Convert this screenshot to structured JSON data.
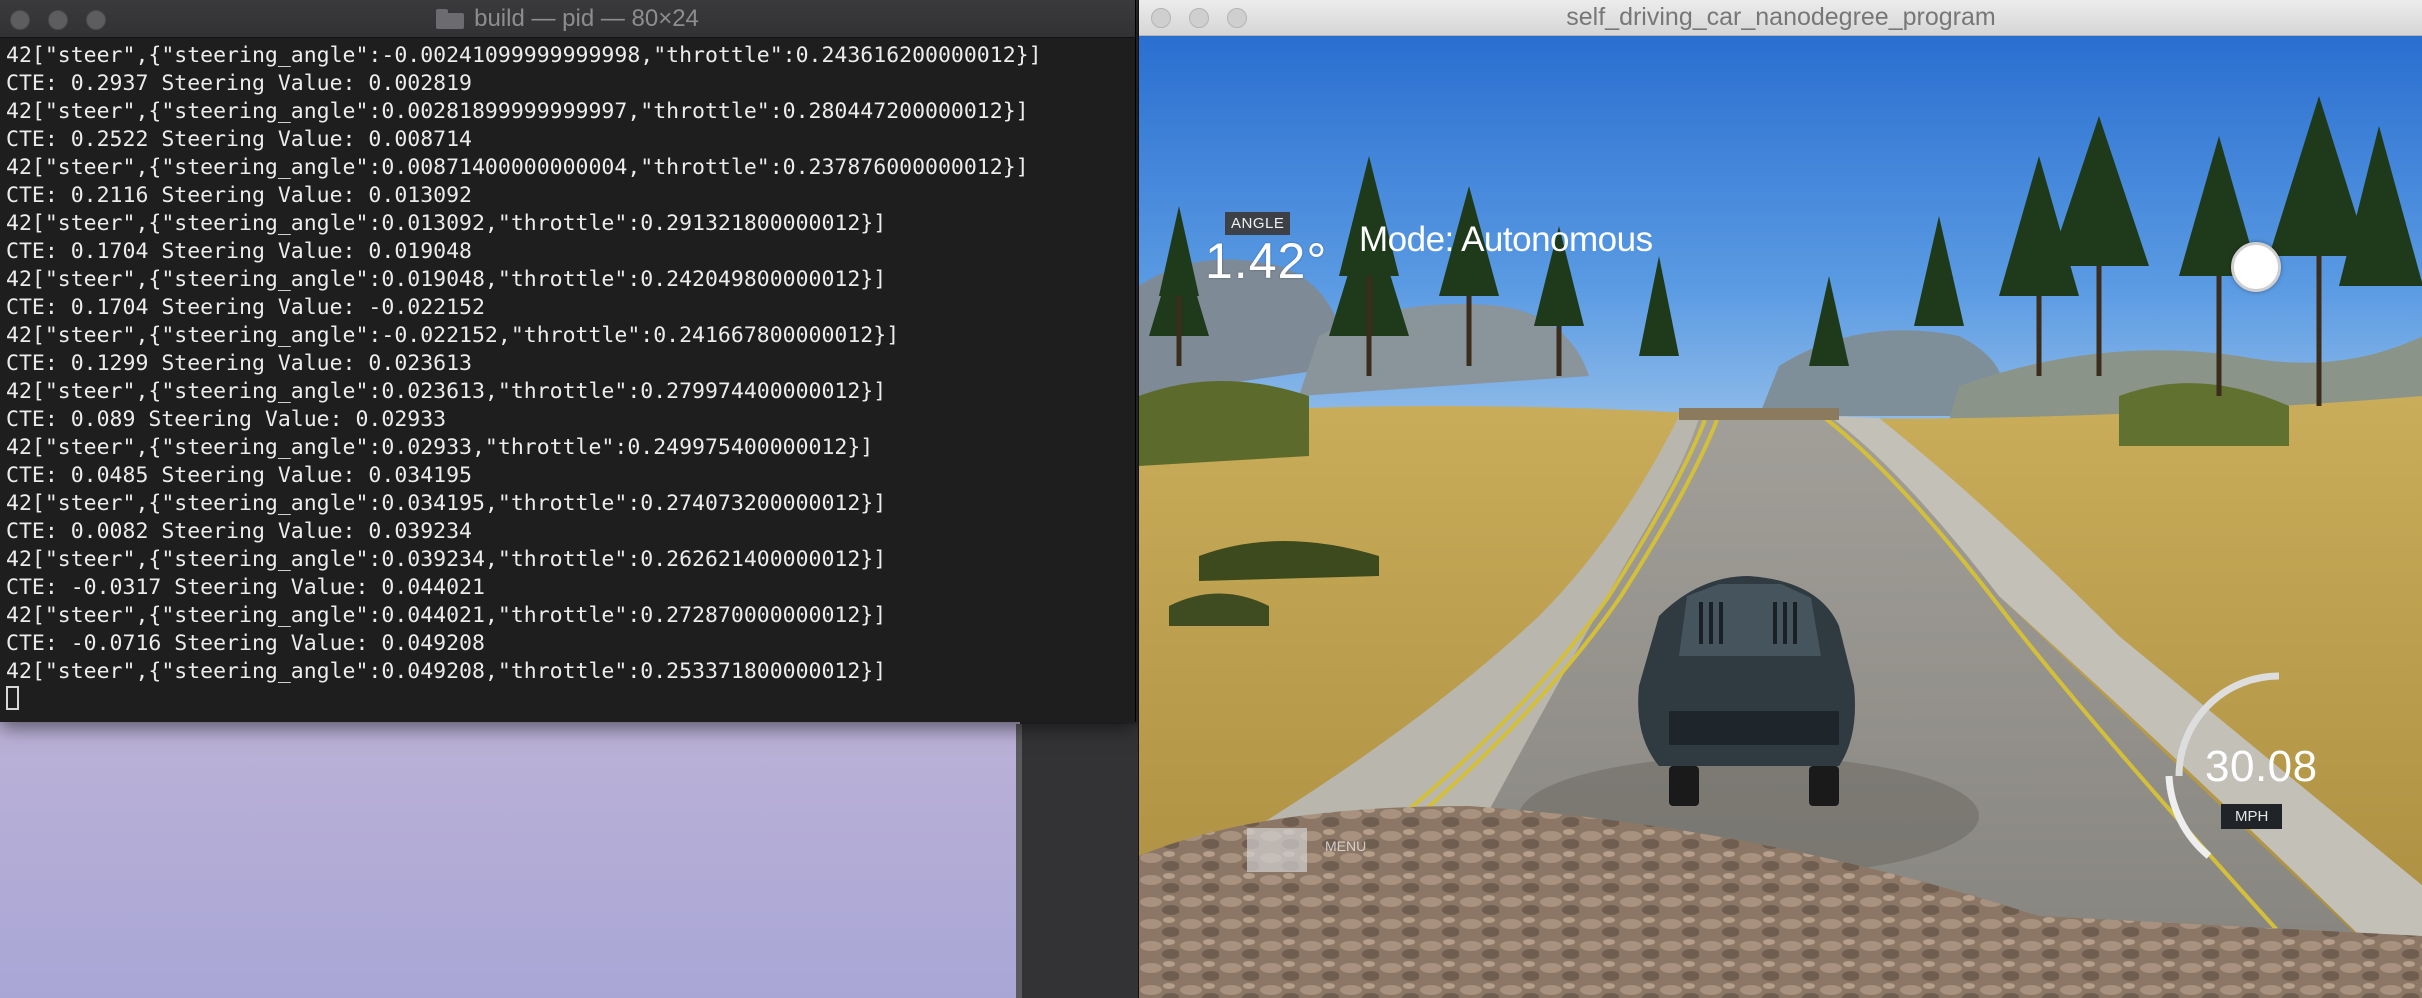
{
  "terminal": {
    "title": "build — pid — 80×24",
    "lines": [
      "42[\"steer\",{\"steering_angle\":-0.00241099999999998,\"throttle\":0.243616200000012}]",
      "CTE: 0.2937 Steering Value: 0.002819",
      "42[\"steer\",{\"steering_angle\":0.00281899999999997,\"throttle\":0.280447200000012}]",
      "CTE: 0.2522 Steering Value: 0.008714",
      "42[\"steer\",{\"steering_angle\":0.00871400000000004,\"throttle\":0.237876000000012}]",
      "CTE: 0.2116 Steering Value: 0.013092",
      "42[\"steer\",{\"steering_angle\":0.013092,\"throttle\":0.291321800000012}]",
      "CTE: 0.1704 Steering Value: 0.019048",
      "42[\"steer\",{\"steering_angle\":0.019048,\"throttle\":0.242049800000012}]",
      "CTE: 0.1704 Steering Value: -0.022152",
      "42[\"steer\",{\"steering_angle\":-0.022152,\"throttle\":0.241667800000012}]",
      "CTE: 0.1299 Steering Value: 0.023613",
      "42[\"steer\",{\"steering_angle\":0.023613,\"throttle\":0.279974400000012}]",
      "CTE: 0.089 Steering Value: 0.02933",
      "42[\"steer\",{\"steering_angle\":0.02933,\"throttle\":0.249975400000012}]",
      "CTE: 0.0485 Steering Value: 0.034195",
      "42[\"steer\",{\"steering_angle\":0.034195,\"throttle\":0.274073200000012}]",
      "CTE: 0.0082 Steering Value: 0.039234",
      "42[\"steer\",{\"steering_angle\":0.039234,\"throttle\":0.262621400000012}]",
      "CTE: -0.0317 Steering Value: 0.044021",
      "42[\"steer\",{\"steering_angle\":0.044021,\"throttle\":0.272870000000012}]",
      "CTE: -0.0716 Steering Value: 0.049208",
      "42[\"steer\",{\"steering_angle\":0.049208,\"throttle\":0.253371800000012}]"
    ]
  },
  "simulator": {
    "title": "self_driving_car_nanodegree_program",
    "hud": {
      "angle_label": "ANGLE",
      "angle_value": "1.42°",
      "mode": "Mode: Autonomous",
      "speed": "30.08",
      "speed_unit": "MPH",
      "menu_label": "MENU"
    }
  },
  "colors": {
    "terminal_bg": "#1e1e1e",
    "terminal_text": "#ececec",
    "sky": "#3f86d8",
    "grass": "#b89a4a",
    "road": "#8b8a86",
    "lane_line": "#d9c33a",
    "car": "#2f3a41"
  },
  "icons": [
    "close-icon",
    "minimize-icon",
    "zoom-icon",
    "folder-icon",
    "steering-indicator-icon"
  ]
}
